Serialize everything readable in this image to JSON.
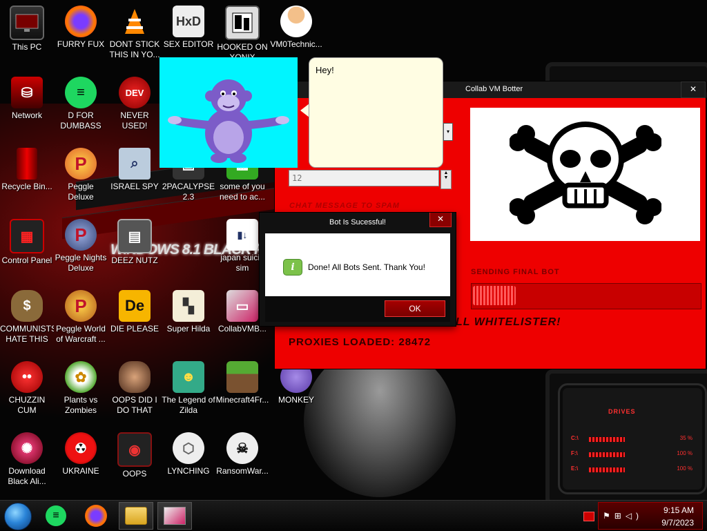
{
  "desktop": {
    "icons": [
      {
        "label": "This PC",
        "icon": "monitor-icon"
      },
      {
        "label": "FURRY FUX",
        "icon": "firefox-icon"
      },
      {
        "label": "DONT STICK\nTHIS IN YO...",
        "icon": "vlc-icon"
      },
      {
        "label": "SEX EDITOR",
        "icon": "hxd-icon"
      },
      {
        "label": "HOOKED ON\nXONIX",
        "icon": "xonix-icon"
      },
      {
        "label": "VM0Technic...",
        "icon": "doctor-icon"
      },
      {
        "label": "Network",
        "icon": "network-icon"
      },
      {
        "label": "D FOR\nDUMBASS",
        "icon": "spotify-icon"
      },
      {
        "label": "NEVER USED!",
        "icon": "dev-cpp-icon"
      },
      {
        "label": "Recycle Bin...",
        "icon": "recycle-bin-icon"
      },
      {
        "label": "Peggle Deluxe",
        "icon": "peggle-icon"
      },
      {
        "label": "ISRAEL SPY",
        "icon": "spy-icon"
      },
      {
        "label": "2PACALYPSE\n2.3",
        "icon": "2pac-icon"
      },
      {
        "label": "some of you\nneed to ac...",
        "icon": "image-icon"
      },
      {
        "label": "Control Panel",
        "icon": "control-panel-icon"
      },
      {
        "label": "Peggle Nights\nDeluxe",
        "icon": "peggle-nights-icon"
      },
      {
        "label": "DEEZ NUTZ",
        "icon": "folder-stack-icon"
      },
      {
        "label": "japan suicid\nsim",
        "icon": "japan-sim-icon"
      },
      {
        "label": "COMMUNISTS\nHATE THIS G...",
        "icon": "money-bag-icon"
      },
      {
        "label": "Peggle World\nof Warcraft ...",
        "icon": "peggle-wow-icon"
      },
      {
        "label": "DIE PLEASE",
        "icon": "de-icon"
      },
      {
        "label": "Super Hilda",
        "icon": "hilda-icon"
      },
      {
        "label": "CollabVMB...",
        "icon": "collabvm-icon"
      },
      {
        "label": "CHUZZIN\nCUM",
        "icon": "chuzzle-icon"
      },
      {
        "label": "Plants vs\nZombies",
        "icon": "pvz-icon"
      },
      {
        "label": "OOPS DID I\nDO THAT",
        "icon": "portrait-icon"
      },
      {
        "label": "The Legend of\nZilda",
        "icon": "zilda-icon"
      },
      {
        "label": "Minecraft4Fr...",
        "icon": "minecraft-icon"
      },
      {
        "label": "MONKEY",
        "icon": "bonzi-icon"
      },
      {
        "label": "Download\nBlack Ali...",
        "icon": "alien-icon"
      },
      {
        "label": "UKRAINE",
        "icon": "radiation-icon"
      },
      {
        "label": "OOPS",
        "icon": "oops-icon"
      },
      {
        "label": "LYNCHING",
        "icon": "lynching-icon"
      },
      {
        "label": "RansomWar...",
        "icon": "ransomware-icon"
      }
    ]
  },
  "wallpaper": {
    "banner": "WiNDOWS 8.1 BLACK PE",
    "drives_title": "DRIVES",
    "drives": [
      {
        "letter": "C:\\",
        "value": "35 %"
      },
      {
        "letter": "F:\\",
        "value": "100 %"
      },
      {
        "letter": "E:\\",
        "value": "100 %"
      }
    ]
  },
  "bonzi": {
    "balloon_text": "Hey!"
  },
  "botter": {
    "title": "Collab VM Botter",
    "close": "✕",
    "count_value": "12",
    "chat_label": "CHAT MESSAGE TO SPAM",
    "sending_label": "SENDING FINAL BOT",
    "progress": 0.19,
    "whitelister_text": "LL WHITELISTER!",
    "proxies_text": "PROXIES LOADED: 28472"
  },
  "dialog": {
    "title": "Bot Is Sucessful!",
    "close": "✕",
    "icon_letter": "i",
    "message": "Done! All Bots Sent. Thank You!",
    "ok_label": "OK"
  },
  "taskbar": {
    "items": [
      "start-orb",
      "spotify-icon",
      "firefox-icon",
      "explorer-icon",
      "collabvm-icon"
    ],
    "clock_time": "9:15 AM",
    "clock_date": "9/7/2023"
  },
  "colors": {
    "accent": "#ee0000",
    "dialog_button": "#8a0000",
    "bonzi_bg": "#00f5ff"
  }
}
